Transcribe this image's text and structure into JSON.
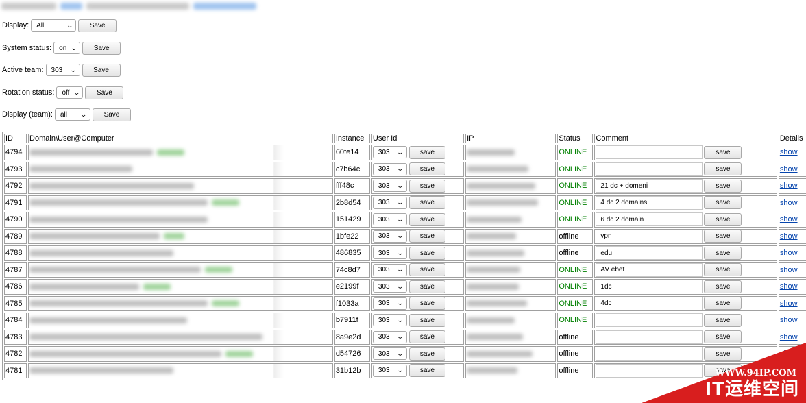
{
  "controls": [
    {
      "label": "Display:",
      "value": "All",
      "save": "Save"
    },
    {
      "label": "System status:",
      "value": "on",
      "save": "Save"
    },
    {
      "label": "Active team:",
      "value": "303",
      "save": "Save"
    },
    {
      "label": "Rotation status:",
      "value": "off",
      "save": "Save"
    },
    {
      "label": "Display (team):",
      "value": "all",
      "save": "Save"
    }
  ],
  "table": {
    "headers": [
      "ID",
      "Domain\\User@Computer",
      "Instance",
      "User Id",
      "IP",
      "Status",
      "Comment",
      "Details"
    ],
    "save_label": "save",
    "show_label": "show",
    "rows": [
      {
        "id": "4794",
        "instance": "60fe14",
        "user": "303",
        "status": "ONLINE",
        "comment": ""
      },
      {
        "id": "4793",
        "instance": "c7b64c",
        "user": "303",
        "status": "ONLINE",
        "comment": ""
      },
      {
        "id": "4792",
        "instance": "fff48c",
        "user": "303",
        "status": "ONLINE",
        "comment": "21 dc + domeni"
      },
      {
        "id": "4791",
        "instance": "2b8d54",
        "user": "303",
        "status": "ONLINE",
        "comment": "4 dc 2 domains"
      },
      {
        "id": "4790",
        "instance": "151429",
        "user": "303",
        "status": "ONLINE",
        "comment": "6 dc 2 domain"
      },
      {
        "id": "4789",
        "instance": "1bfe22",
        "user": "303",
        "status": "offline",
        "comment": "vpn"
      },
      {
        "id": "4788",
        "instance": "486835",
        "user": "303",
        "status": "offline",
        "comment": "edu"
      },
      {
        "id": "4787",
        "instance": "74c8d7",
        "user": "303",
        "status": "ONLINE",
        "comment": "AV ebet"
      },
      {
        "id": "4786",
        "instance": "e2199f",
        "user": "303",
        "status": "ONLINE",
        "comment": "1dc"
      },
      {
        "id": "4785",
        "instance": "f1033a",
        "user": "303",
        "status": "ONLINE",
        "comment": "4dc"
      },
      {
        "id": "4784",
        "instance": "b7911f",
        "user": "303",
        "status": "ONLINE",
        "comment": ""
      },
      {
        "id": "4783",
        "instance": "8a9e2d",
        "user": "303",
        "status": "offline",
        "comment": ""
      },
      {
        "id": "4782",
        "instance": "d54726",
        "user": "303",
        "status": "offline",
        "comment": ""
      },
      {
        "id": "4781",
        "instance": "31b12b",
        "user": "303",
        "status": "offline",
        "comment": ""
      }
    ]
  },
  "watermark": {
    "url": "WWW.94IP.COM",
    "brand": "IT运维空间"
  },
  "colors": {
    "online": "#008000",
    "link": "#0645ad",
    "watermark": "#d81e1e"
  }
}
